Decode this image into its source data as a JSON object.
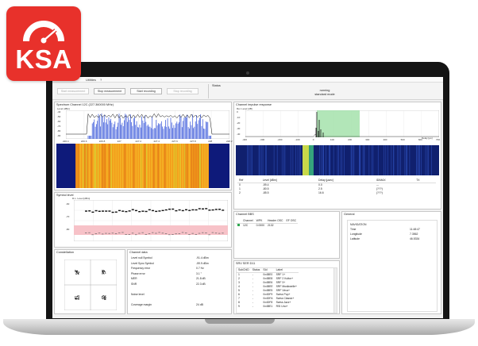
{
  "logo": {
    "text": "KSA",
    "color": "#e8312b"
  },
  "menu": {
    "utilities": "Utilities",
    "help": "?"
  },
  "toolbar": {
    "start_measurement": "Start measurement",
    "stop_measurement": "Stop measurement",
    "start_recording": "Start recording",
    "stop_recording": "Stop recording"
  },
  "status": {
    "label": "Status",
    "line1": "running",
    "line2": "standard mode"
  },
  "spectrum": {
    "title": "Spectrum Channel 12C (227.360000 MHz)",
    "ylabel": "Level (dBm)",
    "y_ticks": [
      "-40",
      "-50",
      "-60",
      "-70",
      "-80",
      "-90"
    ],
    "x_ticks": [
      "226.4",
      "226.6",
      "226.8",
      "227",
      "227.2",
      "227.4",
      "227.6",
      "227.8",
      "228",
      "228.2"
    ]
  },
  "impulse": {
    "title": "Channel impulse response",
    "ylabel": "Rel. Level (dB)",
    "y_ticks": [
      "0",
      "-10",
      "-20",
      "-30",
      "-40"
    ],
    "x_ticks": [
      "-400",
      "-300",
      "-200",
      "-100",
      "0",
      "100",
      "200",
      "300",
      "400",
      "500",
      "600",
      "700"
    ],
    "xlabel": "Delay [µs]",
    "table": {
      "headers": [
        "Ref",
        "Level [dBm]",
        "Delay [µsec]",
        "ID/MAX",
        "TX"
      ],
      "rows": [
        [
          "0",
          "-59.4",
          "0.0",
          "---",
          ""
        ],
        [
          "1",
          "-80.5",
          "2.5",
          "(???)",
          ""
        ],
        [
          "2",
          "-85.5",
          "16.6",
          "(???)",
          ""
        ]
      ]
    }
  },
  "symbol_level": {
    "title": "Symbol level",
    "ylabel": "R.L. Level [dBm]",
    "y_ticks": [
      "-60",
      "-70",
      "-80"
    ],
    "xlabel": "Time [sec]"
  },
  "constellation": {
    "title": "Constellation"
  },
  "channel_stats": {
    "title": "Channel data",
    "rows": [
      {
        "label": "Level null Symbol",
        "value": "-91.4 dBm"
      },
      {
        "label": "Level Sync Symbol",
        "value": "-59.9 dBm"
      },
      {
        "label": "Frequency error",
        "value": "0.7 Hz"
      },
      {
        "label": "Phase error",
        "value": "3.1 °"
      },
      {
        "label": "MER",
        "value": "21.8 dB"
      },
      {
        "label": "SNR",
        "value": "22.3 dB"
      },
      {
        "label": "",
        "value": ""
      },
      {
        "label": "Noise level",
        "value": ""
      },
      {
        "label": "",
        "value": ""
      },
      {
        "label": "Coverage margin",
        "value": "24 dB"
      }
    ]
  },
  "channel_bbs": {
    "title": "Channel BBS",
    "headers": [
      "Channel",
      "WPK",
      "Header OSC",
      "EF OSC"
    ],
    "rows": [
      [
        "12C",
        "0.0000",
        "2132",
        ""
      ]
    ]
  },
  "general": {
    "title": "General",
    "rows": [
      {
        "label": "NAVIGATION",
        "value": ""
      },
      {
        "label": "Time",
        "value": "11:48:47"
      },
      {
        "label": "Longitude",
        "value": "7.3562"
      },
      {
        "label": "Latitude",
        "value": "46.5334"
      }
    ]
  },
  "service_list": {
    "title": "SRV SER D11",
    "headers": [
      "SubChID",
      "Status",
      "SId",
      "Label"
    ],
    "rows": [
      [
        "1",
        "-",
        "0x4BE0",
        "SRF 1+"
      ],
      [
        "2",
        "-",
        "0x4BE8",
        "SRF 2 Kultur+"
      ],
      [
        "3",
        "-",
        "0x4BE6",
        "SRF 3+"
      ],
      [
        "4",
        "-",
        "0x4BEE",
        "SRF Musikwelle+"
      ],
      [
        "5",
        "-",
        "0x4BE5",
        "SRF Virus+"
      ],
      [
        "6",
        "-",
        "0x4DF9",
        "Swiss Pop+"
      ],
      [
        "7",
        "-",
        "0x4DFA",
        "Swiss Classic+"
      ],
      [
        "8",
        "-",
        "0x4DF8",
        "Swiss Jazz+"
      ],
      [
        "9",
        "-",
        "0x4BE1",
        "RSI Uno+"
      ]
    ]
  },
  "colors": {
    "bar": "#2f4fd8",
    "heat": "#f29a1a",
    "highlight": "#9fe0a6",
    "band": "#f7c2c8"
  }
}
